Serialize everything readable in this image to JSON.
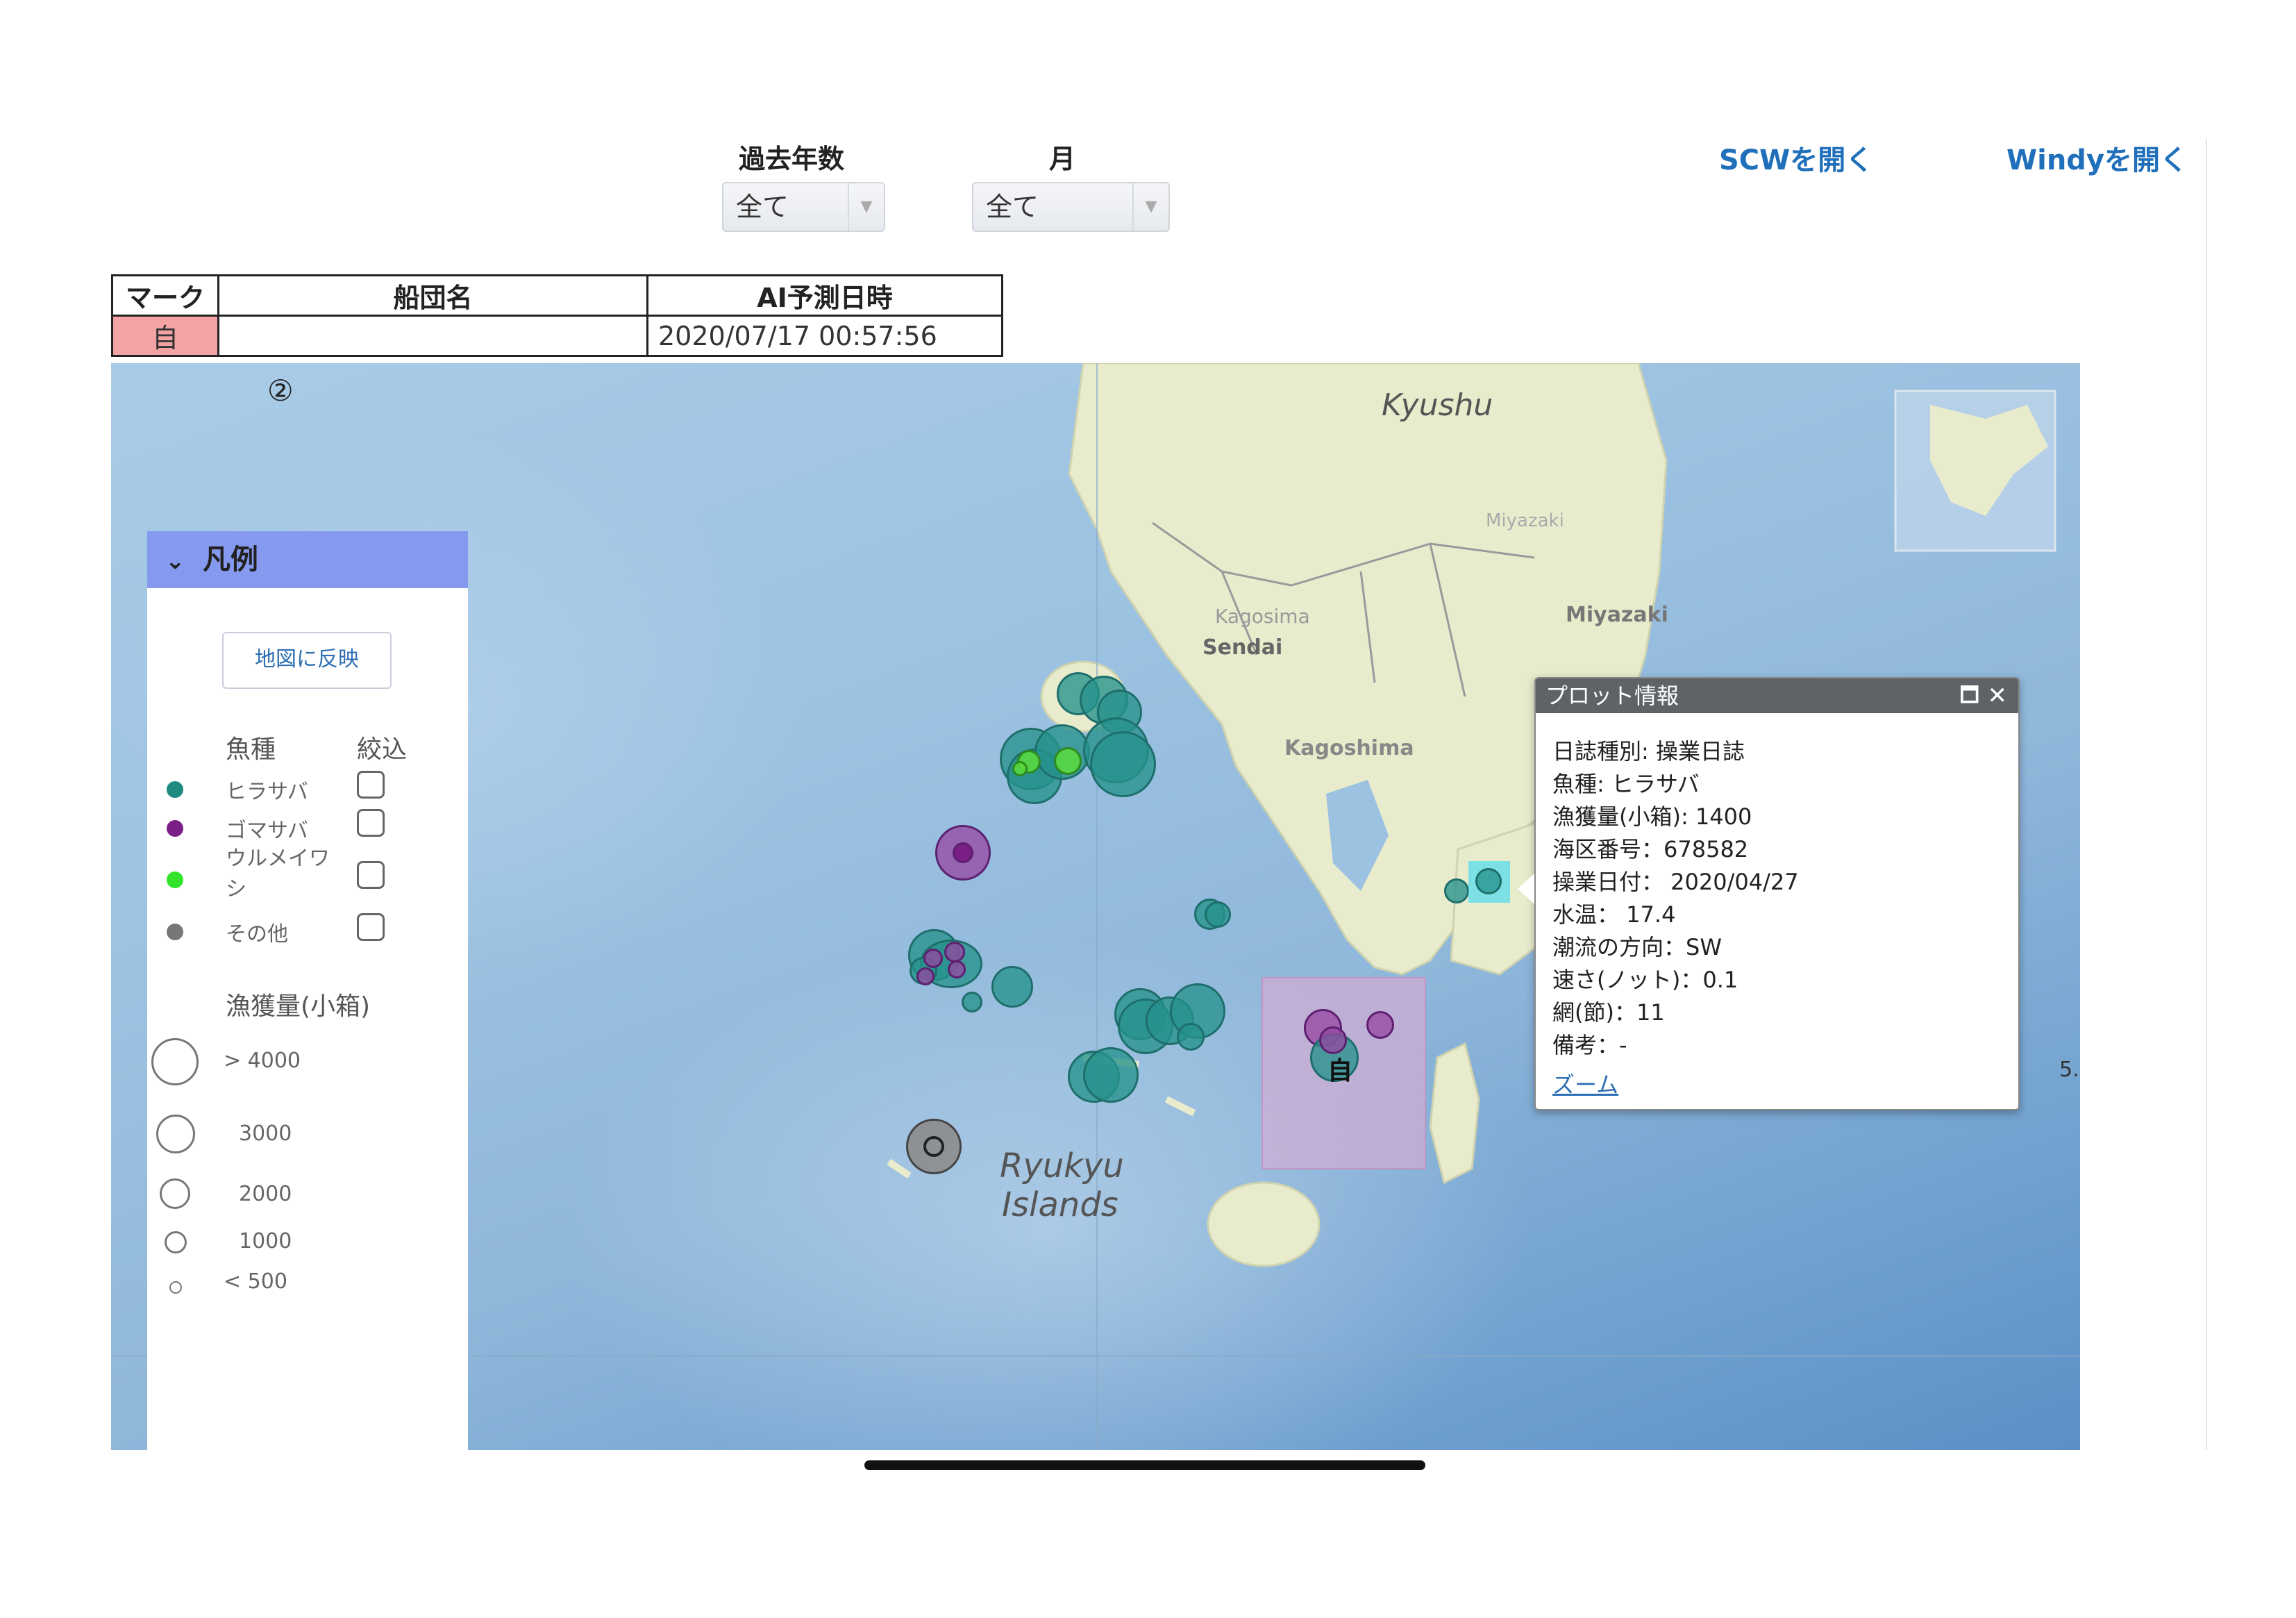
{
  "controls": {
    "years_label": "過去年数",
    "years_value": "全て",
    "month_label": "月",
    "month_value": "全て",
    "scw_link": "SCWを開く",
    "windy_link": "Windyを開く"
  },
  "table": {
    "headers": [
      "マーク",
      "船団名",
      "AI予測日時"
    ],
    "row": {
      "mark": "自",
      "fleet": "",
      "datetime": "2020/07/17 00:57:56"
    }
  },
  "map": {
    "labels": {
      "circled_number": "②",
      "kyushu": "Kyushu",
      "miyazaki_pref": "Miyazaki",
      "miyazaki_city": "Miyazaki",
      "kagoshima_pref": "Kagosima",
      "sendai": "Sendai",
      "kagoshima_city": "Kagoshima",
      "ryukyu1": "Ryukyu",
      "ryukyu2": "Islands",
      "edge": "5.",
      "own_mark": "自"
    }
  },
  "legend": {
    "title": "凡例",
    "apply_button": "地図に反映",
    "species_header": "魚種",
    "filter_header": "絞込",
    "species": [
      {
        "name": "ヒラサバ",
        "color": "#1f8a80"
      },
      {
        "name": "ゴマサバ",
        "color": "#7b1e86"
      },
      {
        "name": "ウルメイワシ",
        "color": "#33e22a"
      },
      {
        "name": "その他",
        "color": "#777777"
      }
    ],
    "catch_header": "漁獲量(小箱)",
    "sizes": [
      "> 4000",
      "3000",
      "2000",
      "1000",
      "< 500"
    ]
  },
  "popup": {
    "title": "プロット情報",
    "lines": [
      "日誌種別: 操業日誌",
      "魚種: ヒラサバ",
      "漁獲量(小箱): 1400",
      "海区番号：678582",
      "操業日付： 2020/04/27",
      "水温： 17.4",
      "潮流の方向：SW",
      "速さ(ノット)：0.1",
      "網(節)：11",
      "備考：-"
    ],
    "zoom_link": "ズーム"
  },
  "colors": {
    "accent": "#1f6fba",
    "legend_header": "#8599ee",
    "mark_cell": "#f3a3a3"
  }
}
